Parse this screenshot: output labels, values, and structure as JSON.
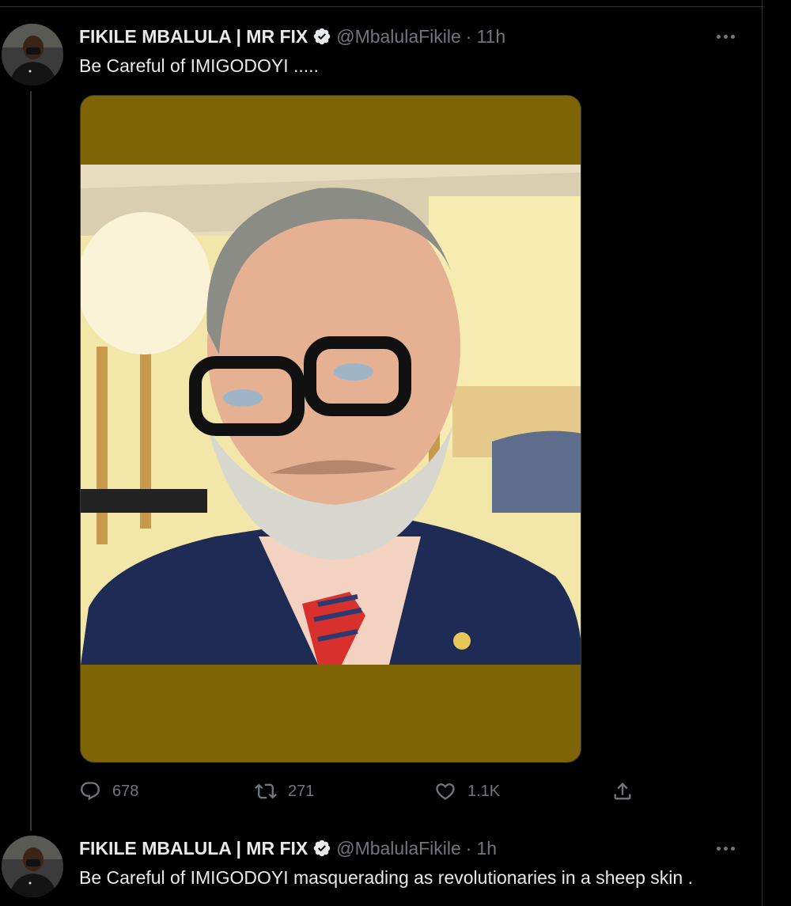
{
  "tweets": [
    {
      "display_name": "FIKILE MBALULA | MR FIX",
      "handle": "@MbalulaFikile",
      "separator": "·",
      "time": "11h",
      "text": "Be Careful of IMIGODOYI .....",
      "stats": {
        "replies": "678",
        "retweets": "271",
        "likes": "1.1K"
      }
    },
    {
      "display_name": "FIKILE MBALULA | MR FIX",
      "handle": "@MbalulaFikile",
      "separator": "·",
      "time": "1h",
      "text": "Be Careful of IMIGODOYI masquerading as revolutionaries in a sheep skin ."
    }
  ],
  "icons": {
    "verified": "verified-badge-icon",
    "more": "more-options-icon",
    "reply": "reply-icon",
    "retweet": "retweet-icon",
    "like": "heart-icon",
    "share": "share-icon"
  },
  "colors": {
    "background": "#000000",
    "text": "#e7e9ea",
    "secondary": "#71767b",
    "media_background": "#7e6404"
  }
}
